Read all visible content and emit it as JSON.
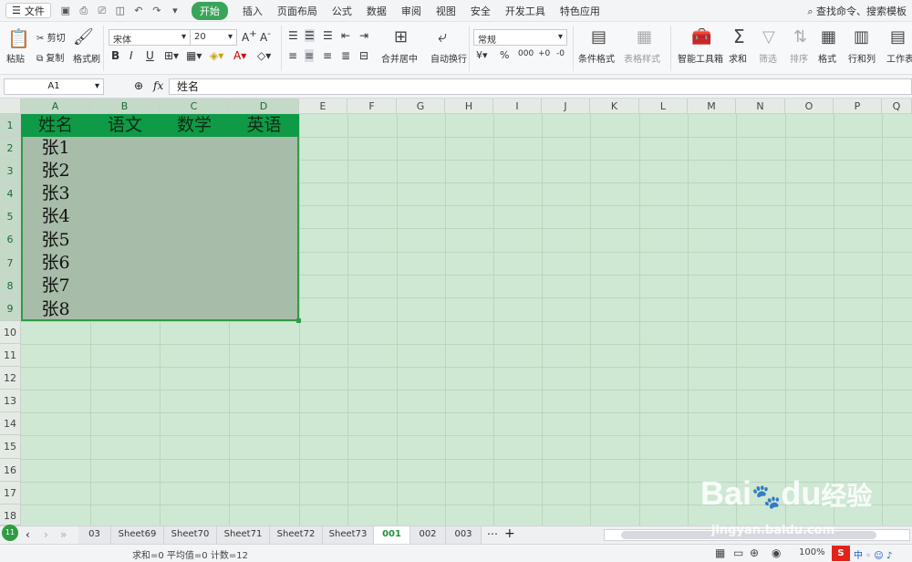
{
  "menu": {
    "file": "文件",
    "tabs": [
      "开始",
      "插入",
      "页面布局",
      "公式",
      "数据",
      "审阅",
      "视图",
      "安全",
      "开发工具",
      "特色应用"
    ],
    "active_tab": "开始",
    "search": "查找命令、搜索模板"
  },
  "ribbon": {
    "paste": "粘贴",
    "cut": "剪切",
    "copy": "复制",
    "format_painter": "格式刷",
    "font_name": "宋体",
    "font_size": "20",
    "bold": "B",
    "italic": "I",
    "underline": "U",
    "merge_center": "合并居中",
    "wrap_text": "自动换行",
    "number_format": "常规",
    "conditional_format": "条件格式",
    "table_style": "表格样式",
    "smart_toolbox": "智能工具箱",
    "sum": "求和",
    "filter": "筛选",
    "sort": "排序",
    "format": "格式",
    "row_col": "行和列",
    "worksheet": "工作表"
  },
  "formula_bar": {
    "name_box": "A1",
    "fx": "fx",
    "content": "姓名"
  },
  "columns": [
    "A",
    "B",
    "C",
    "D",
    "E",
    "F",
    "G",
    "H",
    "I",
    "J",
    "K",
    "L",
    "M",
    "N",
    "O",
    "P",
    "Q"
  ],
  "rows": [
    "1",
    "2",
    "3",
    "4",
    "5",
    "6",
    "7",
    "8",
    "9",
    "10",
    "11",
    "12",
    "13",
    "14",
    "15",
    "16",
    "17",
    "18"
  ],
  "table": {
    "headers": [
      "姓名",
      "语文",
      "数学",
      "英语"
    ],
    "names": [
      "张1",
      "张2",
      "张3",
      "张4",
      "张5",
      "张6",
      "张7",
      "张8"
    ]
  },
  "sheets": {
    "tabs": [
      "03",
      "Sheet69",
      "Sheet70",
      "Sheet71",
      "Sheet72",
      "Sheet73",
      "001",
      "002",
      "003"
    ],
    "active": "001"
  },
  "status": {
    "text": "求和=0  平均值=0  计数=12",
    "zoom": "100%"
  },
  "watermark": {
    "brand": "Bai",
    "brand2": "du",
    "brand3": "经验",
    "url": "jingyan.baidu.com"
  }
}
